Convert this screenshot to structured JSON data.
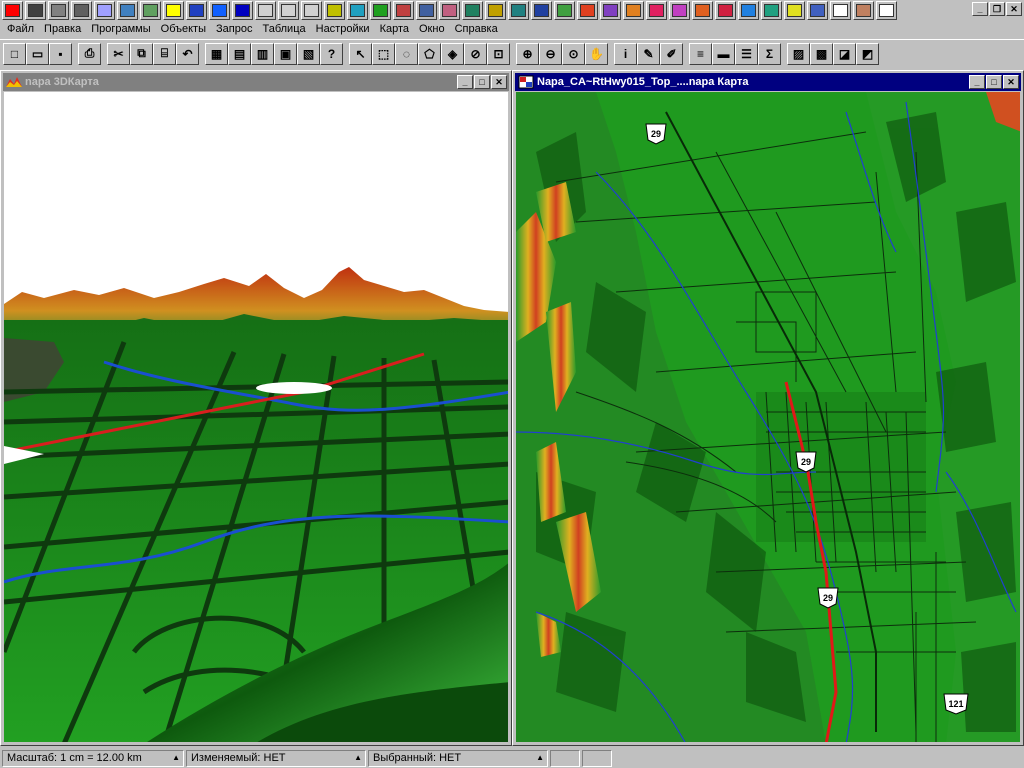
{
  "app_toolbar": {
    "buttons": [
      {
        "name": "mapinfo-logo-button",
        "color": "#ff0000"
      },
      {
        "name": "app-button-2",
        "color": "#404040"
      },
      {
        "name": "app-button-3",
        "color": "#808080"
      },
      {
        "name": "app-button-4",
        "color": "#606060"
      },
      {
        "name": "app-button-5",
        "color": "#a0a0ff"
      },
      {
        "name": "app-button-6",
        "color": "#4080c0"
      },
      {
        "name": "app-button-7",
        "color": "#60a060"
      },
      {
        "name": "smiley-button",
        "color": "#ffff00"
      },
      {
        "name": "app-button-9",
        "color": "#2040c0"
      },
      {
        "name": "ie-button",
        "color": "#1060ff"
      },
      {
        "name": "ftp-button",
        "color": "#0000c0"
      },
      {
        "name": "app-button-12",
        "color": "#d0d0d0"
      },
      {
        "name": "app-button-13",
        "color": "#d0d0d0"
      },
      {
        "name": "app-button-14",
        "color": "#d0d0d0"
      },
      {
        "name": "app-button-15",
        "color": "#c0c000"
      },
      {
        "name": "app-button-16",
        "color": "#20a0c0"
      },
      {
        "name": "app-button-17",
        "color": "#20a020"
      },
      {
        "name": "app-button-18",
        "color": "#c04040"
      },
      {
        "name": "app-button-19",
        "color": "#4060a0"
      },
      {
        "name": "app-button-20",
        "color": "#c06080"
      },
      {
        "name": "app-button-21",
        "color": "#208060"
      },
      {
        "name": "app-button-22",
        "color": "#c0a000"
      },
      {
        "name": "app-button-23",
        "color": "#208080"
      },
      {
        "name": "app-button-24",
        "color": "#2040a0"
      },
      {
        "name": "app-button-25",
        "color": "#40a040"
      },
      {
        "name": "app-button-26",
        "color": "#e04020"
      },
      {
        "name": "app-button-27",
        "color": "#8040c0"
      },
      {
        "name": "app-button-28",
        "color": "#e08020"
      },
      {
        "name": "app-button-29",
        "color": "#e02060"
      },
      {
        "name": "app-button-30",
        "color": "#c040c0"
      },
      {
        "name": "app-button-31",
        "color": "#e06020"
      },
      {
        "name": "app-button-32",
        "color": "#d02040"
      },
      {
        "name": "app-button-33",
        "color": "#2080e0"
      },
      {
        "name": "app-button-34",
        "color": "#20a080"
      },
      {
        "name": "app-button-35",
        "color": "#e0e020"
      },
      {
        "name": "app-button-36",
        "color": "#4060c0"
      },
      {
        "name": "help-button",
        "color": "#ffffff"
      },
      {
        "name": "app-button-38",
        "color": "#c08060"
      },
      {
        "name": "app-button-39",
        "color": "#ffffff"
      }
    ],
    "window_controls": {
      "minimize": "_",
      "restore": "❐",
      "close": "✕"
    }
  },
  "menu": [
    "Файл",
    "Правка",
    "Программы",
    "Объекты",
    "Запрос",
    "Таблица",
    "Настройки",
    "Карта",
    "Окно",
    "Справка"
  ],
  "main_toolbar": {
    "buttons": [
      {
        "name": "new-button",
        "glyph": "□"
      },
      {
        "name": "open-button",
        "glyph": "▭"
      },
      {
        "name": "save-button",
        "glyph": "▪"
      },
      {
        "gap": true
      },
      {
        "name": "print-button",
        "glyph": "⎙"
      },
      {
        "gap": true
      },
      {
        "name": "cut-button",
        "glyph": "✂"
      },
      {
        "name": "copy-button",
        "glyph": "⧉"
      },
      {
        "name": "paste-button",
        "glyph": "⌸"
      },
      {
        "name": "undo-button",
        "glyph": "↶"
      },
      {
        "gap": true
      },
      {
        "name": "new-browser-button",
        "glyph": "▦"
      },
      {
        "name": "new-mapper-button",
        "glyph": "▤"
      },
      {
        "name": "new-grapher-button",
        "glyph": "▥"
      },
      {
        "name": "new-layout-button",
        "glyph": "▣"
      },
      {
        "name": "new-redistrict-button",
        "glyph": "▧"
      },
      {
        "name": "help-pointer-button",
        "glyph": "?"
      },
      {
        "gap": true
      },
      {
        "name": "select-tool",
        "glyph": "↖"
      },
      {
        "name": "marquee-select-tool",
        "glyph": "⬚"
      },
      {
        "name": "radius-select-tool",
        "glyph": "◌"
      },
      {
        "name": "polygon-select-tool",
        "glyph": "⬠"
      },
      {
        "name": "boundary-select-tool",
        "glyph": "◈"
      },
      {
        "name": "unselect-tool",
        "glyph": "⊘"
      },
      {
        "name": "graph-select-tool",
        "glyph": "⊡"
      },
      {
        "gap": true
      },
      {
        "name": "zoom-in-tool",
        "glyph": "⊕"
      },
      {
        "name": "zoom-out-tool",
        "glyph": "⊖"
      },
      {
        "name": "change-view-tool",
        "glyph": "⊙"
      },
      {
        "name": "grabber-tool",
        "glyph": "✋"
      },
      {
        "gap": true
      },
      {
        "name": "info-tool",
        "glyph": "i"
      },
      {
        "name": "label-tool",
        "glyph": "✎"
      },
      {
        "name": "drag-window-tool",
        "glyph": "✐"
      },
      {
        "gap": true
      },
      {
        "name": "layer-control-button",
        "glyph": "≡"
      },
      {
        "name": "ruler-tool",
        "glyph": "▬"
      },
      {
        "name": "legend-button",
        "glyph": "☰"
      },
      {
        "name": "statistics-button",
        "glyph": "Σ"
      },
      {
        "gap": true
      },
      {
        "name": "setting-tool-1",
        "glyph": "▨"
      },
      {
        "name": "setting-tool-2",
        "glyph": "▩"
      },
      {
        "name": "setting-tool-3",
        "glyph": "◪"
      },
      {
        "name": "setting-tool-4",
        "glyph": "◩"
      }
    ]
  },
  "windows": {
    "view3d": {
      "title": "napa 3DКарта",
      "state": "inactive",
      "controls": {
        "minimize": "_",
        "maximize": "□",
        "close": "✕"
      },
      "colors": {
        "sky": "#ffffff",
        "ground": "#1d8a1d",
        "roads": "#0e3a0e",
        "river": "#1a4fd0",
        "highway": "#d81e1e"
      }
    },
    "map": {
      "title": "Napa_CA~RtHwy015_Top_....napa Карта",
      "state": "active",
      "controls": {
        "minimize": "_",
        "maximize": "□",
        "close": "✕"
      },
      "shields": [
        "29",
        "29",
        "29",
        "121"
      ],
      "colors": {
        "terrain": "#1f9a1f",
        "roads": "#0c2e0c",
        "rivers": "#2040d0",
        "highway": "#e01818",
        "peaks": "#e0a020"
      }
    }
  },
  "status": {
    "scale": "Масштаб: 1 cm = 12.00 km",
    "editable": "Изменяемый: НЕТ",
    "selectable": "Выбранный: НЕТ",
    "extra1": "",
    "extra2": ""
  }
}
